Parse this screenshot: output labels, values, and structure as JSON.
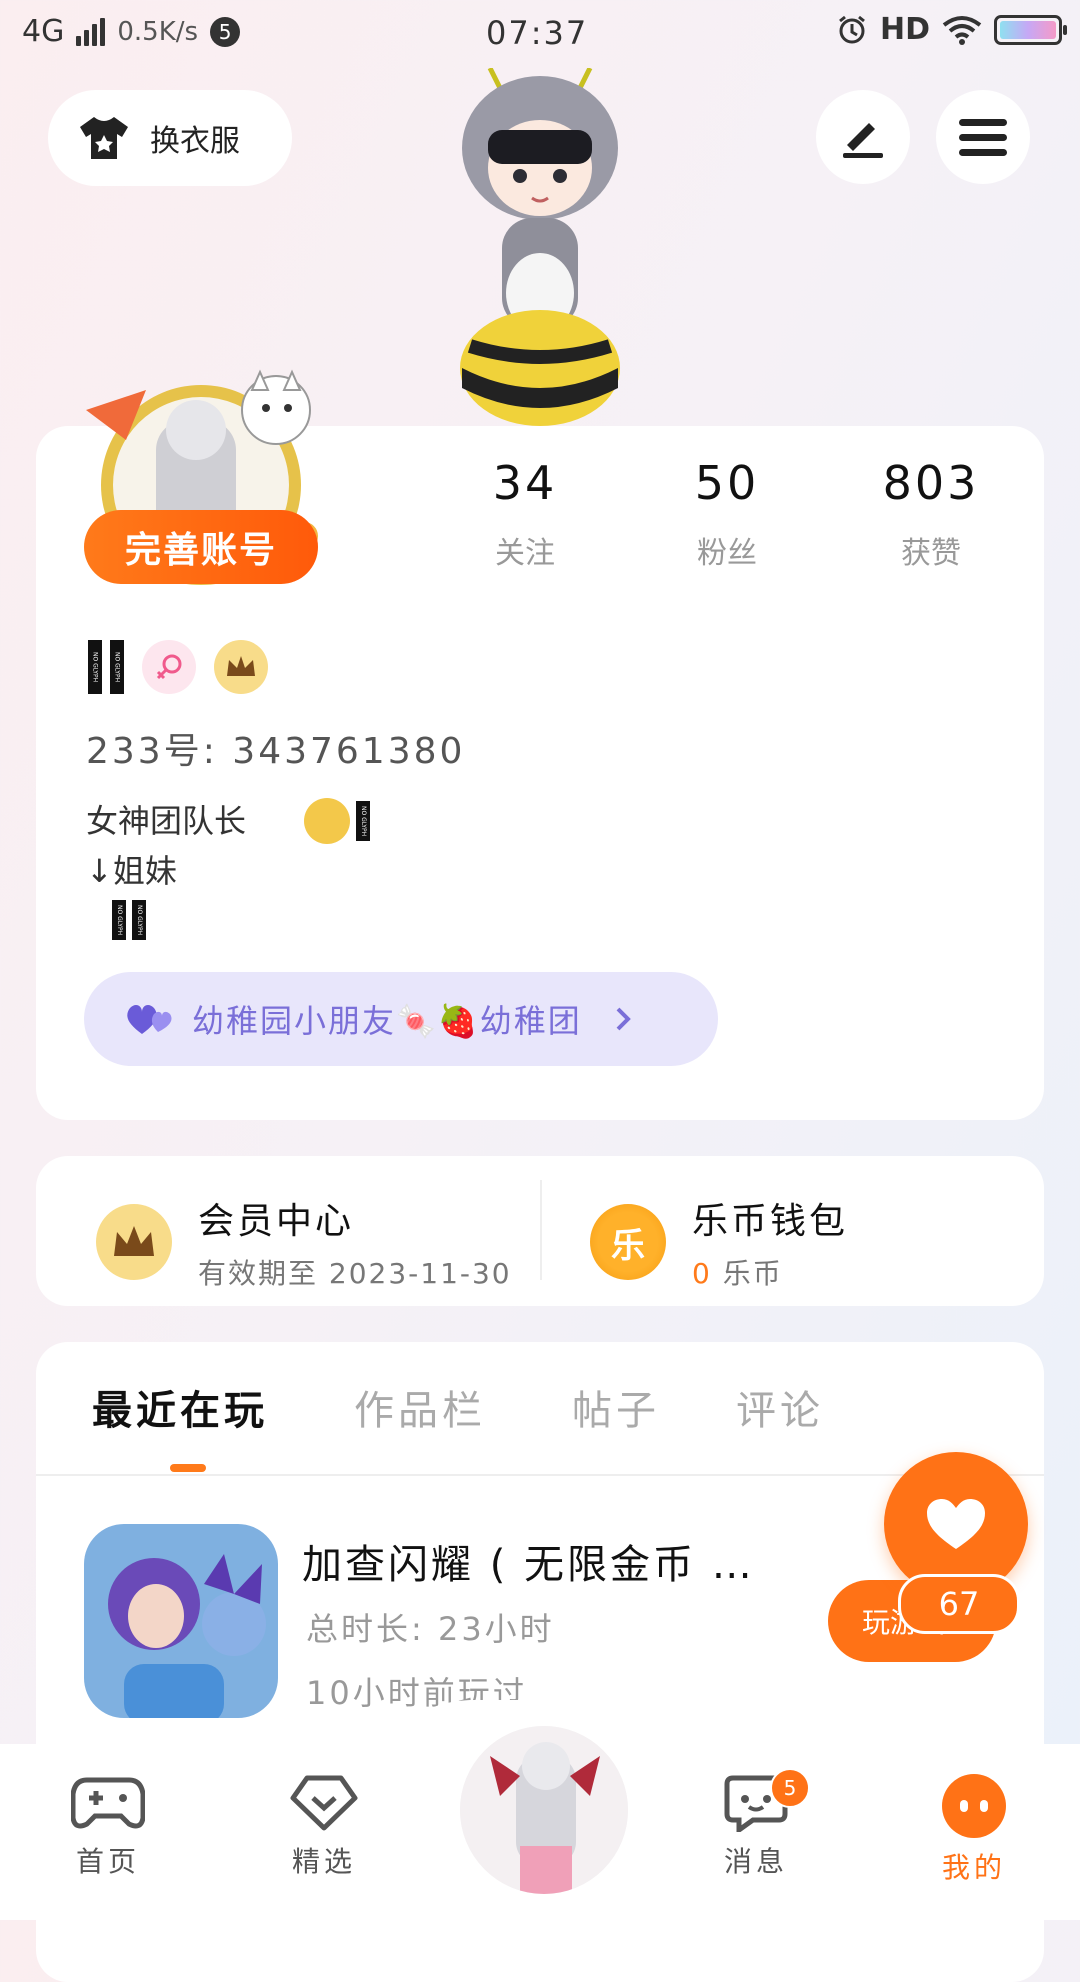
{
  "status_bar": {
    "network": "4G",
    "speed": "0.5K/s",
    "notif_count": "5",
    "time": "07:37",
    "hd": "HD"
  },
  "top": {
    "outfit_label": "换衣服"
  },
  "profile": {
    "complete_label": "完善账号",
    "stats": [
      {
        "value": "34",
        "label": "关注"
      },
      {
        "value": "50",
        "label": "粉丝"
      },
      {
        "value": "803",
        "label": "获赞"
      }
    ],
    "id_line": "233号: 343761380",
    "bio_line1": "女神团队长",
    "bio_line2": "↓姐妹",
    "group_label": "幼稚园小朋友🍬🍓幼稚团"
  },
  "member": {
    "title": "会员中心",
    "subtitle": "有效期至 2023-11-30",
    "wallet_title": "乐币钱包",
    "wallet_amount": "0",
    "wallet_unit": "乐币",
    "coin_char": "乐"
  },
  "tabs": [
    "最近在玩",
    "作品栏",
    "帖子",
    "评论"
  ],
  "recent_game": {
    "title": "加查闪耀 ( 无限金币 …",
    "duration": "总时长: 23小时",
    "last_played": "10小时前玩过",
    "play_label": "玩游戏"
  },
  "like": {
    "count": "67"
  },
  "nav": {
    "items": [
      "首页",
      "精选",
      "消息",
      "我的"
    ],
    "msg_badge": "5"
  },
  "colors": {
    "accent": "#ff7216",
    "group_pill_bg": "#e8e6fb",
    "group_pill_text": "#7a6fd8"
  }
}
